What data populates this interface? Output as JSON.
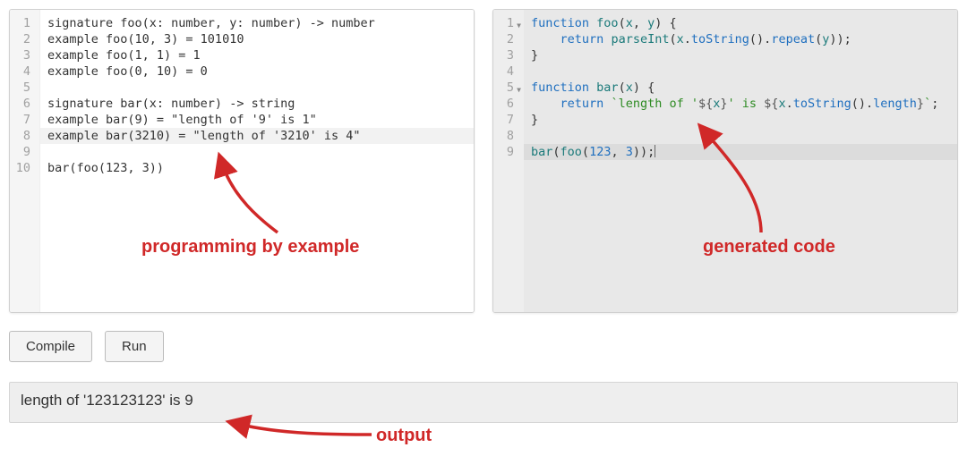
{
  "editor_left": {
    "lines": [
      "signature foo(x: number, y: number) -> number",
      "example foo(10, 3) = 101010",
      "example foo(1, 1) = 1",
      "example foo(0, 10) = 0",
      "",
      "signature bar(x: number) -> string",
      "example bar(9) = \"length of '9' is 1\"",
      "example bar(3210) = \"length of '3210' is 4\"",
      "",
      "bar(foo(123, 3))"
    ],
    "line_numbers": [
      "1",
      "2",
      "3",
      "4",
      "5",
      "6",
      "7",
      "8",
      "9",
      "10"
    ],
    "selected_line_index": 7
  },
  "editor_right": {
    "lines_tokens": [
      [
        {
          "t": "function",
          "c": "kw"
        },
        {
          "t": " "
        },
        {
          "t": "foo",
          "c": "fn"
        },
        {
          "t": "("
        },
        {
          "t": "x",
          "c": "id"
        },
        {
          "t": ", "
        },
        {
          "t": "y",
          "c": "id"
        },
        {
          "t": ") {"
        }
      ],
      [
        {
          "t": "    "
        },
        {
          "t": "return",
          "c": "kw"
        },
        {
          "t": " "
        },
        {
          "t": "parseInt",
          "c": "fn"
        },
        {
          "t": "("
        },
        {
          "t": "x",
          "c": "id"
        },
        {
          "t": "."
        },
        {
          "t": "toString",
          "c": "prop"
        },
        {
          "t": "()."
        },
        {
          "t": "repeat",
          "c": "prop"
        },
        {
          "t": "("
        },
        {
          "t": "y",
          "c": "id"
        },
        {
          "t": "));"
        }
      ],
      [
        {
          "t": "}"
        }
      ],
      [],
      [
        {
          "t": "function",
          "c": "kw"
        },
        {
          "t": " "
        },
        {
          "t": "bar",
          "c": "fn"
        },
        {
          "t": "("
        },
        {
          "t": "x",
          "c": "id"
        },
        {
          "t": ") {"
        }
      ],
      [
        {
          "t": "    "
        },
        {
          "t": "return",
          "c": "kw"
        },
        {
          "t": " "
        },
        {
          "t": "`length of '",
          "c": "str"
        },
        {
          "t": "${",
          "c": "p"
        },
        {
          "t": "x",
          "c": "id"
        },
        {
          "t": "}",
          "c": "p"
        },
        {
          "t": "' is ",
          "c": "str"
        },
        {
          "t": "${",
          "c": "p"
        },
        {
          "t": "x",
          "c": "id"
        },
        {
          "t": "."
        },
        {
          "t": "toString",
          "c": "prop"
        },
        {
          "t": "()."
        },
        {
          "t": "length",
          "c": "prop"
        },
        {
          "t": "}",
          "c": "p"
        },
        {
          "t": "`",
          "c": "str"
        },
        {
          "t": ";"
        }
      ],
      [
        {
          "t": "}"
        }
      ],
      [],
      [
        {
          "t": "bar",
          "c": "fn"
        },
        {
          "t": "("
        },
        {
          "t": "foo",
          "c": "fn"
        },
        {
          "t": "("
        },
        {
          "t": "123",
          "c": "num"
        },
        {
          "t": ", "
        },
        {
          "t": "3",
          "c": "num"
        },
        {
          "t": "));"
        }
      ]
    ],
    "line_numbers": [
      "1",
      "2",
      "3",
      "4",
      "5",
      "6",
      "7",
      "8",
      "9"
    ],
    "fold_lines": [
      0,
      4
    ],
    "selected_line_index": 8
  },
  "buttons": {
    "compile_label": "Compile",
    "run_label": "Run"
  },
  "output": {
    "text": "length of '123123123' is 9"
  },
  "annotations": {
    "left_label": "programming by example",
    "right_label": "generated code",
    "output_label": "output"
  },
  "colors": {
    "accent_red": "#d02828"
  }
}
